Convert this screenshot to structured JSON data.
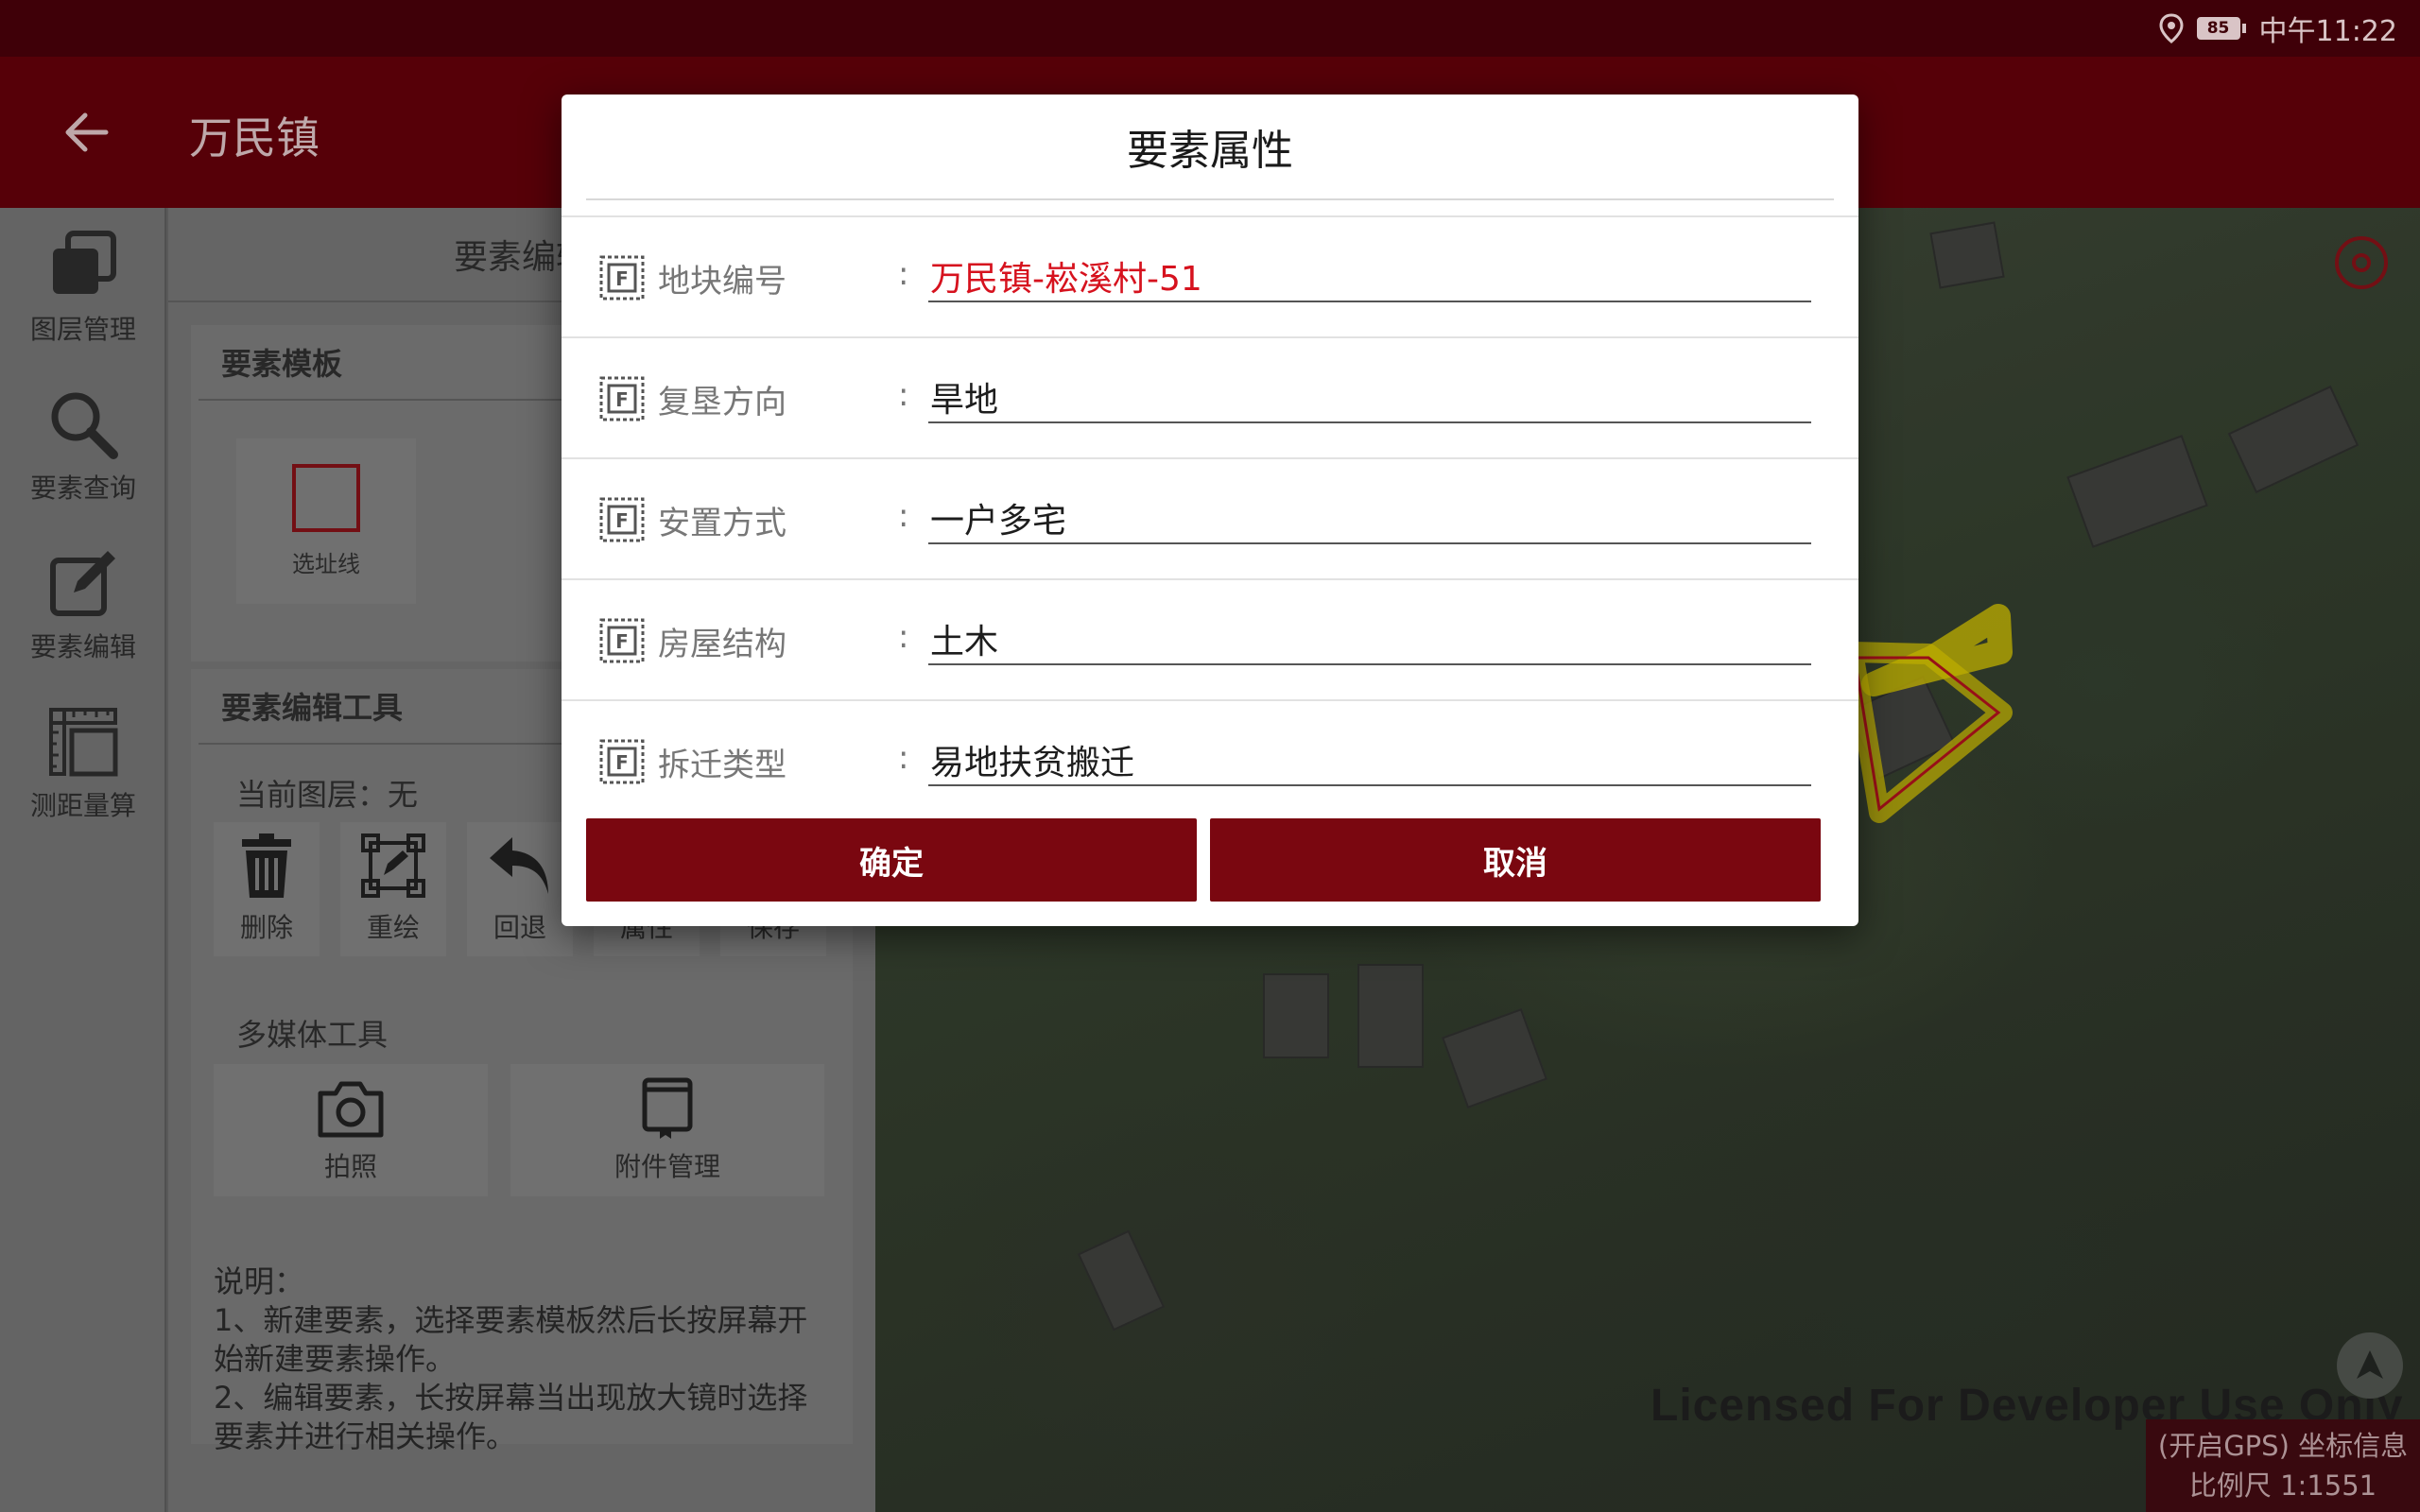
{
  "status_bar": {
    "battery": "85",
    "time": "中午11:22"
  },
  "app_bar": {
    "title": "万民镇"
  },
  "left_nav": [
    {
      "label": "图层管理",
      "icon": "layers-icon"
    },
    {
      "label": "要素查询",
      "icon": "search-icon"
    },
    {
      "label": "要素编辑",
      "icon": "edit-icon"
    },
    {
      "label": "测距量算",
      "icon": "ruler-icon"
    }
  ],
  "panel": {
    "header": "要素编辑",
    "template_card": {
      "title": "要素模板",
      "items": [
        {
          "label": "选址线"
        }
      ]
    },
    "tools_card": {
      "title": "要素编辑工具",
      "current_layer": "当前图层：无",
      "tools": [
        {
          "label": "删除",
          "icon": "trash-icon"
        },
        {
          "label": "重绘",
          "icon": "redraw-icon"
        },
        {
          "label": "回退",
          "icon": "undo-icon"
        },
        {
          "label": "属性",
          "icon": "properties-icon"
        },
        {
          "label": "保存",
          "icon": "save-icon"
        }
      ],
      "multimedia_title": "多媒体工具",
      "multimedia": [
        {
          "label": "拍照",
          "icon": "camera-icon"
        },
        {
          "label": "附件管理",
          "icon": "attachment-icon"
        }
      ]
    },
    "notes": [
      "说明：",
      "1、新建要素，选择要素模板然后长按屏幕开始新建要素操作。",
      "2、编辑要素，长按屏幕当出现放大镜时选择要素并进行相关操作。"
    ]
  },
  "map": {
    "watermark": "Licensed For Developer Use Only",
    "coord_info": "(开启GPS) 坐标信息",
    "scale": "比例尺 1:1551"
  },
  "dialog": {
    "title": "要素属性",
    "fields": [
      {
        "label": "地块编号",
        "value": "万民镇-崧溪村-51",
        "highlight": true
      },
      {
        "label": "复垦方向",
        "value": "旱地"
      },
      {
        "label": "安置方式",
        "value": "一户多宅"
      },
      {
        "label": "房屋结构",
        "value": "土木"
      },
      {
        "label": "拆迁类型",
        "value": "易地扶贫搬迁"
      }
    ],
    "confirm_label": "确定",
    "cancel_label": "取消"
  },
  "colors": {
    "primary": "#7a0710",
    "status_bar": "#3f0008",
    "highlight_text": "#d6121e"
  }
}
